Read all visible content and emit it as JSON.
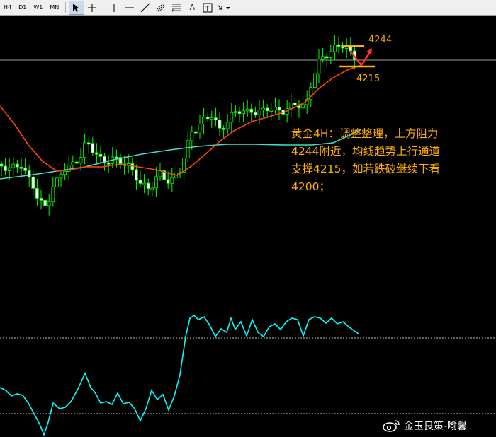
{
  "toolbar": {
    "timeframes": [
      "H4",
      "D1",
      "W1",
      "MN"
    ],
    "text_tool": "A",
    "label_tool": "T"
  },
  "colors": {
    "bull_candle": "#00ff00",
    "bear_candle": "#ffffff",
    "ma_fast": "#ff4500",
    "ma_slow": "#40e0d0",
    "oscillator": "#00ffff",
    "annotation": "#ffb000",
    "arrow": "#ff3030"
  },
  "annotation": {
    "text": "黄金4H：调整整理，上方阻力\n4244附近，均线趋势上行通道\n支撑4215，如若跌破继续下看\n4200；"
  },
  "levels": {
    "resistance_label": "4244",
    "support_label": "4215"
  },
  "watermark": {
    "text": "金玉良策-喻馨"
  }
}
